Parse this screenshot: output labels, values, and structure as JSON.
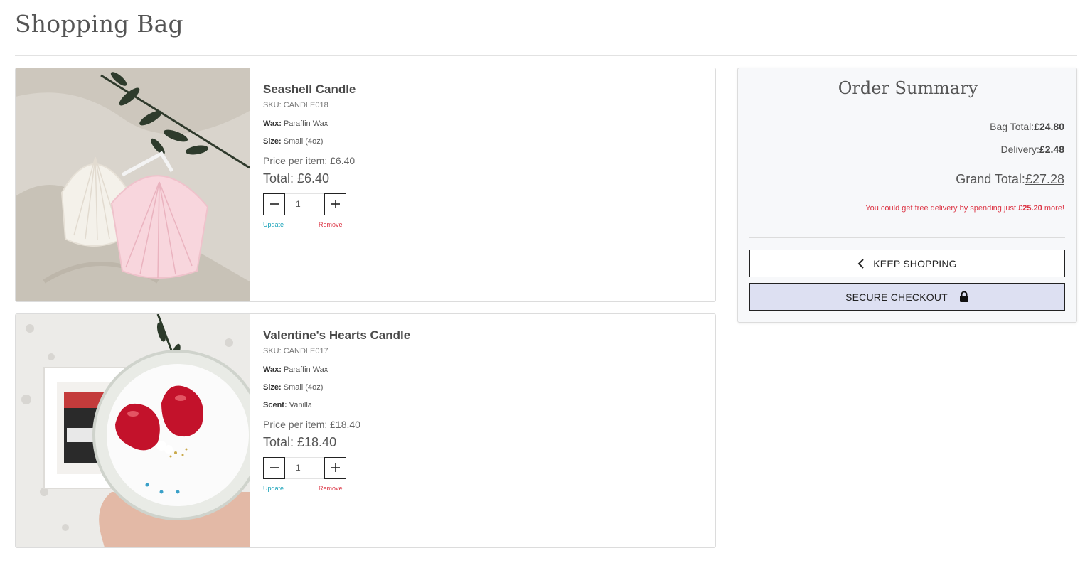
{
  "page": {
    "title": "Shopping Bag"
  },
  "items": [
    {
      "name": "Seashell Candle",
      "sku": "SKU: CANDLE018",
      "attributes": [
        {
          "key": "Wax:",
          "value": "Paraffin Wax"
        },
        {
          "key": "Size:",
          "value": "Small (4oz)"
        }
      ],
      "price_per_item": "Price per item: £6.40",
      "total": "Total: £6.40",
      "quantity": "1",
      "decrease_icon": "minus-icon",
      "increase_icon": "plus-icon",
      "update_label": "Update",
      "remove_label": "Remove"
    },
    {
      "name": "Valentine's Hearts Candle",
      "sku": "SKU: CANDLE017",
      "attributes": [
        {
          "key": "Wax:",
          "value": "Paraffin Wax"
        },
        {
          "key": "Size:",
          "value": "Small (4oz)"
        },
        {
          "key": "Scent:",
          "value": "Vanilla"
        }
      ],
      "price_per_item": "Price per item: £18.40",
      "total": "Total: £18.40",
      "quantity": "1",
      "decrease_icon": "minus-icon",
      "increase_icon": "plus-icon",
      "update_label": "Update",
      "remove_label": "Remove"
    }
  ],
  "summary": {
    "title": "Order Summary",
    "bag_total_label": "Bag Total:",
    "bag_total_value": "£24.80",
    "delivery_label": "Delivery:",
    "delivery_value": "£2.48",
    "grand_total_label": "Grand Total:",
    "grand_total_value": "£27.28",
    "free_delivery_prefix": "You could get free delivery by spending just",
    "free_delivery_amount": "£25.20",
    "free_delivery_suffix": "more!",
    "keep_shopping_label": "KEEP SHOPPING",
    "keep_shopping_icon": "chevron-left-icon",
    "secure_checkout_label": "SECURE CHECKOUT",
    "secure_checkout_icon": "lock-icon"
  },
  "colors": {
    "update_link": "#17a2b8",
    "remove_link": "#dc3545",
    "checkout_button_bg": "#dde0f2",
    "summary_bg": "#f7f8fa"
  }
}
